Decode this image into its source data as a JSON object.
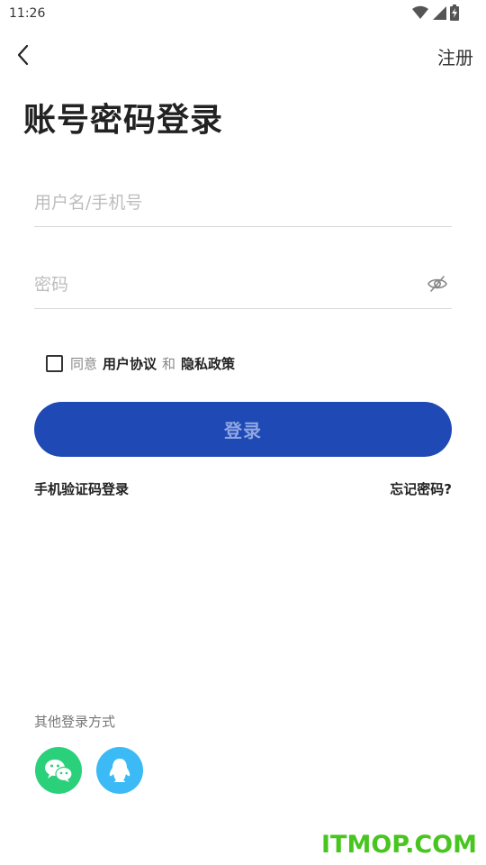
{
  "status_bar": {
    "time": "11:26",
    "icons": [
      "wifi-icon",
      "cell-signal-icon",
      "battery-charging-icon"
    ]
  },
  "header": {
    "back_icon": "chevron-left-icon",
    "register_label": "注册"
  },
  "title": "账号密码登录",
  "form": {
    "username_value": "",
    "username_placeholder": "用户名/手机号",
    "password_value": "",
    "password_placeholder": "密码",
    "password_toggle_icon": "eye-hidden-icon"
  },
  "agreement": {
    "checked": false,
    "prefix": "同意",
    "terms_label": "用户协议",
    "and": "和",
    "privacy_label": "隐私政策"
  },
  "login_button_label": "登录",
  "sms_login_label": "手机验证码登录",
  "forgot_password_label": "忘记密码?",
  "other_login": {
    "title": "其他登录方式",
    "providers": [
      "wechat-icon",
      "qq-icon"
    ]
  },
  "colors": {
    "primary": "#1f49b5",
    "wechat": "#2bd07a",
    "qq": "#3bbaf5",
    "watermark": "#48c51f"
  },
  "watermark": "ITMOP.COM"
}
